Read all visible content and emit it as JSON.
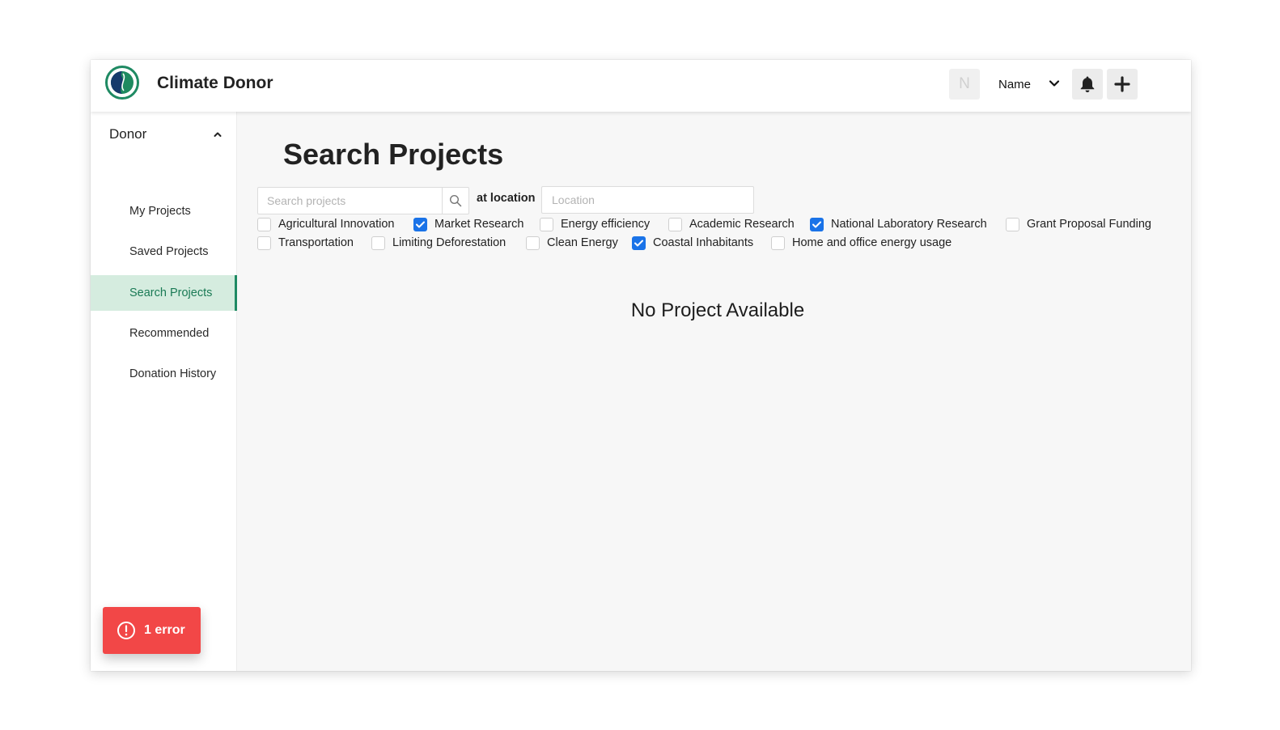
{
  "app": {
    "title": "Climate Donor",
    "accent_color": "#1f8a63"
  },
  "topbar": {
    "avatar_initial": "N",
    "user_name": "Name",
    "icons": [
      "logo-icon",
      "chevron-down-icon",
      "bell-icon",
      "plus-icon"
    ]
  },
  "sidebar": {
    "section_label": "Donor",
    "items": [
      {
        "label": "My Projects",
        "active": false
      },
      {
        "label": "Saved Projects",
        "active": false
      },
      {
        "label": "Search Projects",
        "active": true
      },
      {
        "label": "Recommended",
        "active": false
      },
      {
        "label": "Donation History",
        "active": false
      }
    ]
  },
  "main": {
    "page_title": "Search Projects",
    "search": {
      "placeholder": "Search projects",
      "value": ""
    },
    "location_label": "at location",
    "location": {
      "placeholder": "Location",
      "value": ""
    },
    "filters": [
      {
        "label": "Agricultural Innovation",
        "checked": false
      },
      {
        "label": "Market Research",
        "checked": true
      },
      {
        "label": "Energy efficiency",
        "checked": false
      },
      {
        "label": "Academic Research",
        "checked": false
      },
      {
        "label": "National Laboratory Research",
        "checked": true
      },
      {
        "label": "Grant Proposal Funding",
        "checked": false
      },
      {
        "label": "Transportation",
        "checked": false
      },
      {
        "label": "Limiting Deforestation",
        "checked": false
      },
      {
        "label": "Clean Energy",
        "checked": false
      },
      {
        "label": "Coastal Inhabitants",
        "checked": true
      },
      {
        "label": "Home and office energy usage",
        "checked": false
      }
    ],
    "empty_message": "No Project Available"
  },
  "error_toast": {
    "label": "1 error",
    "color": "#f24747"
  }
}
